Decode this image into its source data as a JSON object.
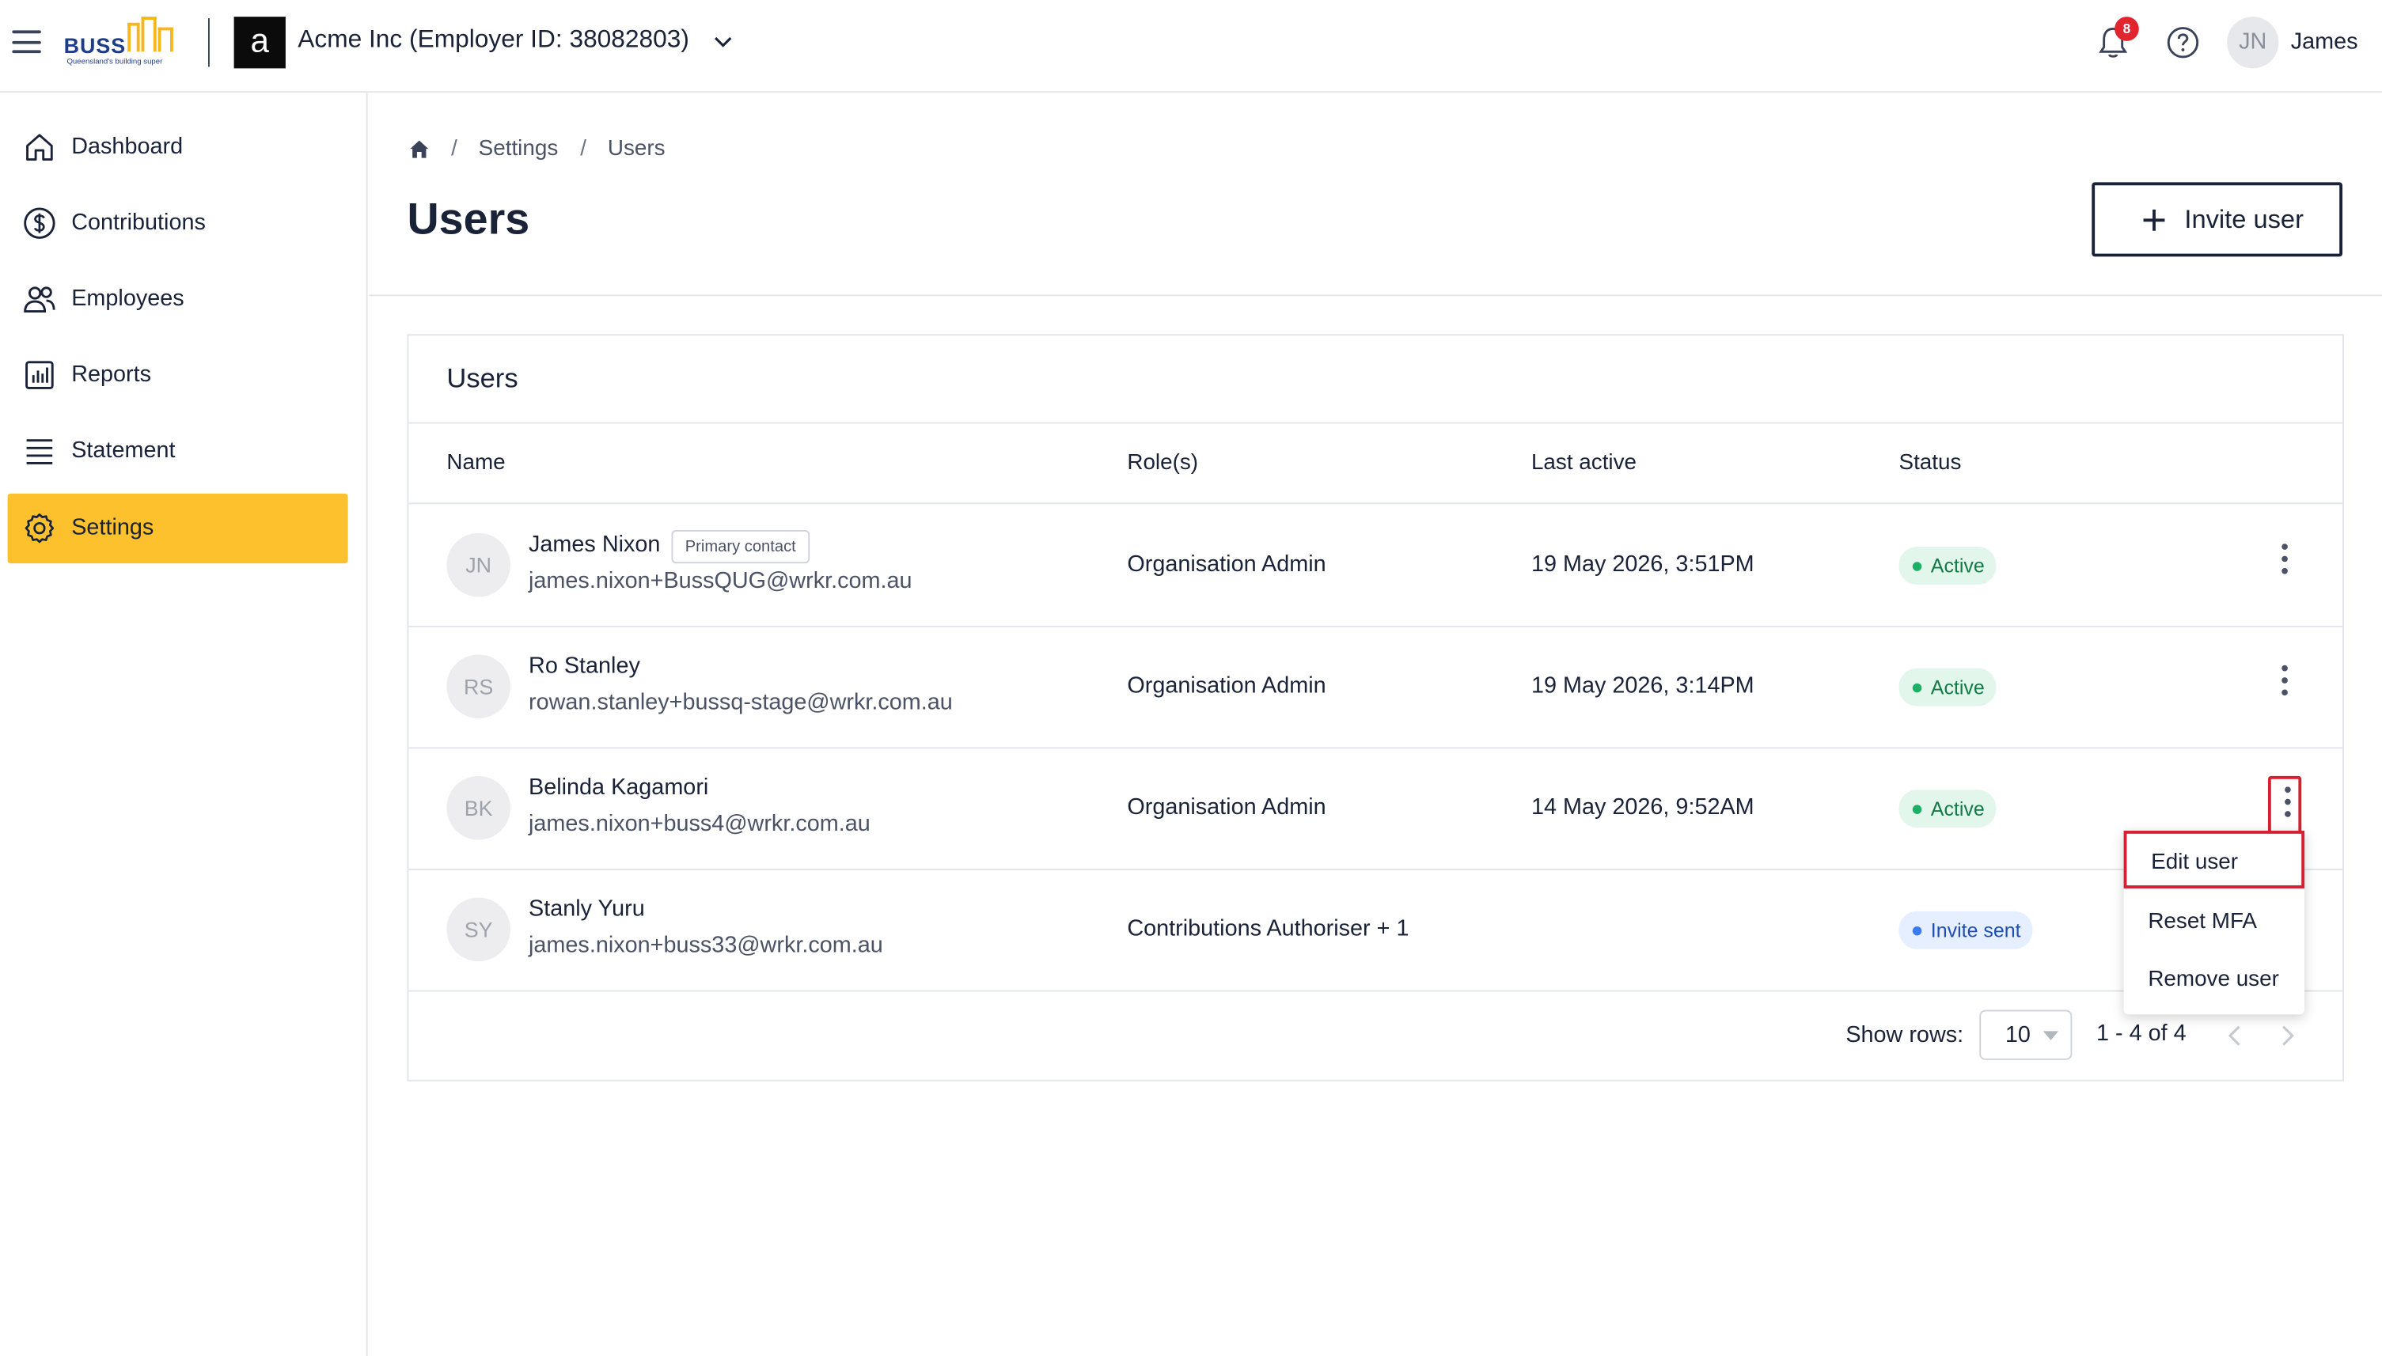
{
  "app": {
    "brand_word": "BUSS",
    "brand_tagline": "Queensland's building super",
    "org_initial": "a",
    "org_name": "Acme Inc (Employer ID: 38082803)",
    "notifications_count": "8",
    "user_initials": "JN",
    "user_name": "James"
  },
  "sidebar": {
    "items": [
      {
        "label": "Dashboard",
        "icon": "home-icon",
        "active": false
      },
      {
        "label": "Contributions",
        "icon": "dollar-icon",
        "active": false
      },
      {
        "label": "Employees",
        "icon": "people-icon",
        "active": false
      },
      {
        "label": "Reports",
        "icon": "bar-chart-icon",
        "active": false
      },
      {
        "label": "Statement",
        "icon": "list-icon",
        "active": false
      },
      {
        "label": "Settings",
        "icon": "gear-icon",
        "active": true
      }
    ]
  },
  "breadcrumb": {
    "home_icon": "home-icon",
    "items": [
      "Settings",
      "Users"
    ],
    "separator": "/"
  },
  "page": {
    "title": "Users",
    "invite_button_label": "Invite user"
  },
  "table": {
    "title": "Users",
    "columns": [
      "Name",
      "Role(s)",
      "Last active",
      "Status"
    ],
    "rows": [
      {
        "initials": "JN",
        "name": "James Nixon",
        "tag": "Primary contact",
        "email": "james.nixon+BussQUG@wrkr.com.au",
        "role": "Organisation Admin",
        "last_active": "19 May 2026, 3:51PM",
        "status": "Active"
      },
      {
        "initials": "RS",
        "name": "Ro Stanley",
        "tag": "",
        "email": "rowan.stanley+bussq-stage@wrkr.com.au",
        "role": "Organisation Admin",
        "last_active": "19 May 2026, 3:14PM",
        "status": "Active"
      },
      {
        "initials": "BK",
        "name": "Belinda Kagamori",
        "tag": "",
        "email": "james.nixon+buss4@wrkr.com.au",
        "role": "Organisation Admin",
        "last_active": "14 May 2026, 9:52AM",
        "status": "Active"
      },
      {
        "initials": "SY",
        "name": "Stanly Yuru",
        "tag": "",
        "email": "james.nixon+buss33@wrkr.com.au",
        "role": "Contributions Authoriser + 1",
        "last_active": "",
        "status": "Invite sent"
      }
    ],
    "row_menu": [
      "Edit user",
      "Reset MFA",
      "Remove user"
    ],
    "footer": {
      "show_rows_label": "Show rows:",
      "rows_value": "10",
      "range_text": "1 - 4 of 4"
    }
  },
  "colors": {
    "accent": "#fcc12c",
    "text": "#1a2238",
    "active_status": "#1bb066",
    "invite_status": "#3a7bf2",
    "highlight": "#d61f30",
    "notification_badge": "#e0252f"
  }
}
